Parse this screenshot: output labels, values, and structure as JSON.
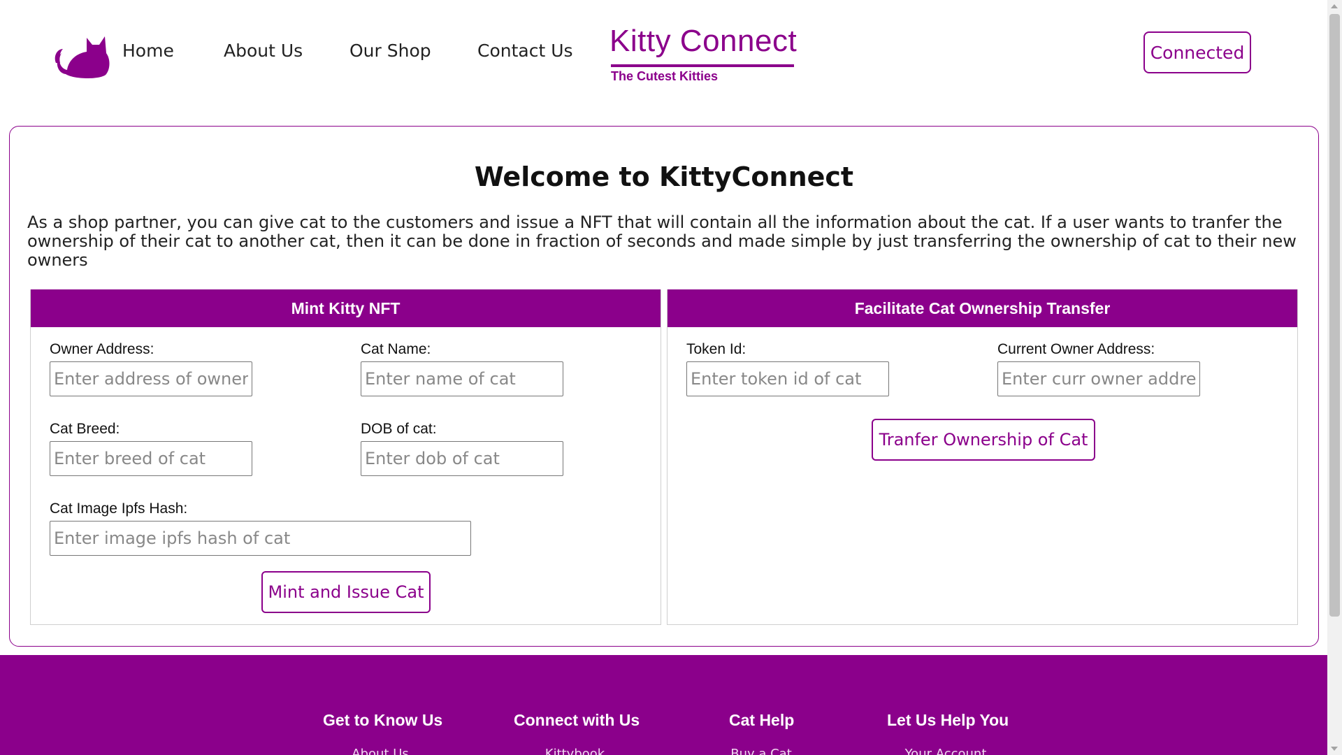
{
  "nav": {
    "links": [
      {
        "label": "Home"
      },
      {
        "label": "About Us"
      },
      {
        "label": "Our Shop"
      },
      {
        "label": "Contact Us"
      }
    ],
    "brand_title": "Kitty Connect",
    "brand_subtitle": "The Cutest Kitties",
    "connect_label": "Connected",
    "logo_icon": "cat-icon"
  },
  "main": {
    "title": "Welcome to KittyConnect",
    "intro": "As a shop partner, you can give cat to the customers and issue a NFT that will contain all the information about the cat. If a user wants to tranfer the ownership of their cat to another cat, then it can be done in fraction of seconds and made simple by just transferring the ownership of cat to their new owners",
    "mint": {
      "heading": "Mint Kitty NFT",
      "owner_label": "Owner Address:",
      "owner_placeholder": "Enter address of owner",
      "name_label": "Cat Name:",
      "name_placeholder": "Enter name of cat",
      "breed_label": "Cat Breed:",
      "breed_placeholder": "Enter breed of cat",
      "dob_label": "DOB of cat:",
      "dob_placeholder": "Enter dob of cat",
      "ipfs_label": "Cat Image Ipfs Hash:",
      "ipfs_placeholder": "Enter image ipfs hash of cat",
      "button": "Mint and Issue Cat"
    },
    "transfer": {
      "heading": "Facilitate Cat Ownership Transfer",
      "token_label": "Token Id:",
      "token_placeholder": "Enter token id of cat",
      "owner_label": "Current Owner Address:",
      "owner_placeholder": "Enter curr owner address",
      "button": "Tranfer Ownership of Cat"
    }
  },
  "footer": {
    "columns": [
      {
        "heading": "Get to Know Us",
        "first_link": "About Us"
      },
      {
        "heading": "Connect with Us",
        "first_link": "Kittybook"
      },
      {
        "heading": "Cat Help",
        "first_link": "Buy a Cat"
      },
      {
        "heading": "Let Us Help You",
        "first_link": "Your Account"
      }
    ]
  },
  "colors": {
    "brand": "#8b008b",
    "text": "#222222",
    "background": "#ffffff"
  }
}
